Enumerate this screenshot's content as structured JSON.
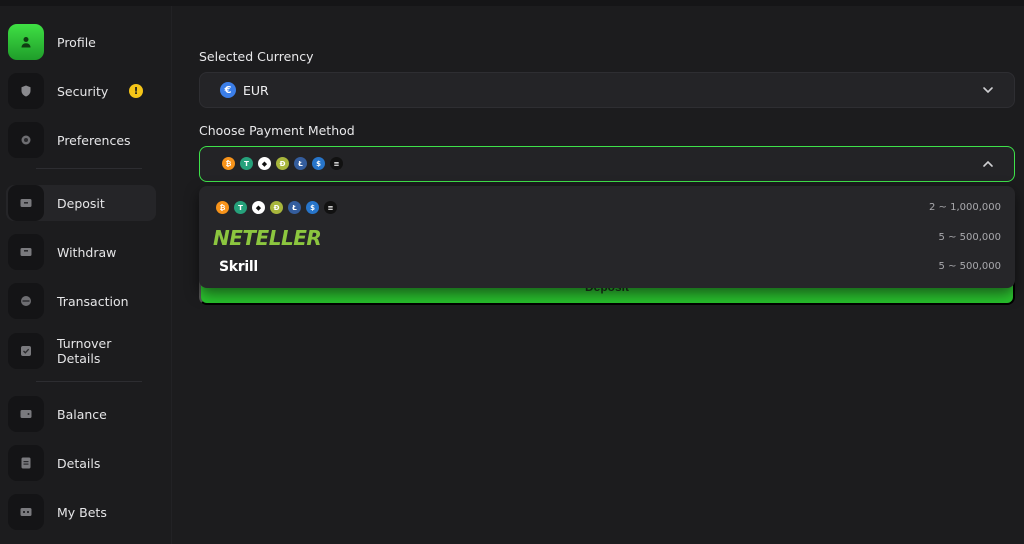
{
  "sidebar": {
    "items": [
      {
        "label": "Profile",
        "icon": "user-icon"
      },
      {
        "label": "Security",
        "icon": "shield-icon",
        "badge": "!"
      },
      {
        "label": "Preferences",
        "icon": "settings-icon"
      },
      {
        "label": "Deposit",
        "icon": "deposit-icon"
      },
      {
        "label": "Withdraw",
        "icon": "withdraw-icon"
      },
      {
        "label": "Transaction",
        "icon": "transaction-icon"
      },
      {
        "label": "Turnover Details",
        "icon": "checklist-icon"
      },
      {
        "label": "Balance",
        "icon": "wallet-icon"
      },
      {
        "label": "Details",
        "icon": "details-icon"
      },
      {
        "label": "My Bets",
        "icon": "bets-icon"
      }
    ]
  },
  "currency": {
    "label": "Selected Currency",
    "value": "EUR",
    "symbol": "€"
  },
  "payment": {
    "label": "Choose Payment Method",
    "coins": [
      {
        "name": "bitcoin-icon",
        "glyph": "₿",
        "color": "#f7931a"
      },
      {
        "name": "tether-icon",
        "glyph": "T",
        "color": "#26a17b"
      },
      {
        "name": "ethereum-icon",
        "glyph": "◆",
        "color": "#ffffff"
      },
      {
        "name": "dogecoin-icon",
        "glyph": "Ð",
        "color": "#a8b63c"
      },
      {
        "name": "litecoin-icon",
        "glyph": "Ł",
        "color": "#345d9d"
      },
      {
        "name": "usdc-icon",
        "glyph": "$",
        "color": "#2775ca"
      },
      {
        "name": "solana-icon",
        "glyph": "≡",
        "color": "#111111"
      }
    ],
    "options": [
      {
        "name": "Crypto",
        "range": "2 ~ 1,000,000"
      },
      {
        "name": "NETELLER",
        "range": "5 ~ 500,000"
      },
      {
        "name": "Skrill",
        "range": "5 ~ 500,000"
      }
    ]
  },
  "deposit_button": "Deposit",
  "colors": {
    "accent": "#3ee24a",
    "background": "#1c1c1e",
    "neteller": "#8cc63f",
    "warning": "#f5c518"
  }
}
